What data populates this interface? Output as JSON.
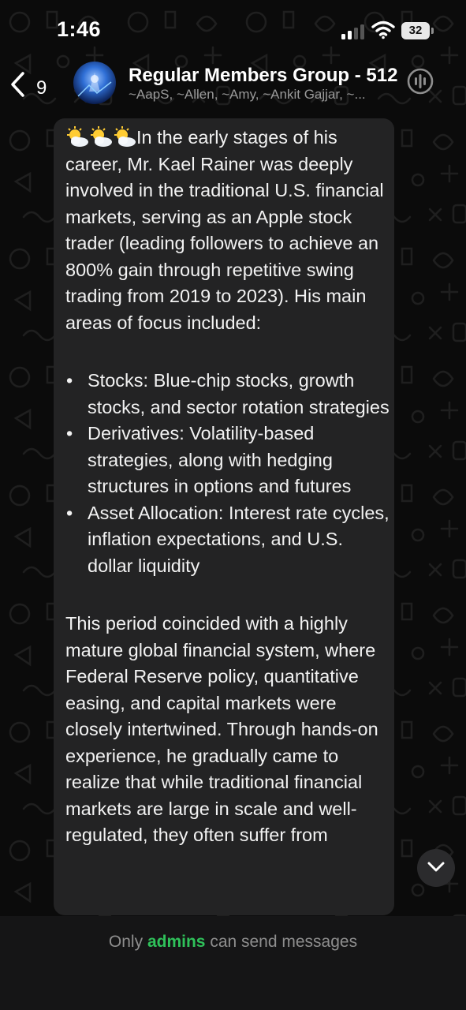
{
  "status_bar": {
    "time": "1:46",
    "battery_level": "32"
  },
  "header": {
    "back_count": "9",
    "title": "Regular Members Group - 512",
    "members": "~AapS, ~Allen, ~Amy, ~Ankit Gajjar, ~..."
  },
  "message": {
    "intro": "In the early stages of his career, Mr. Kael Rainer  was deeply involved in the traditional U.S. financial markets, serving as an Apple stock trader (leading followers to achieve an 800% gain through repetitive swing trading from 2019 to 2023). His main areas of focus included:",
    "bullets": [
      "Stocks: Blue-chip stocks, growth stocks, and sector rotation strategies",
      "Derivatives: Volatility-based strategies, along with hedging structures in options and futures",
      "Asset Allocation: Interest rate cycles, inflation expectations, and U.S. dollar liquidity"
    ],
    "paragraph2": "This period coincided with a highly mature global financial system, where Federal Reserve policy, quantitative easing, and capital markets were closely intertwined. Through hands-on experience, he gradually came to realize that while traditional financial markets are large in scale and well-regulated, they often suffer from"
  },
  "footer": {
    "prefix": "Only",
    "admins": "admins",
    "suffix": "can send messages"
  },
  "icons": {
    "emoji": "sun-behind-cloud-icon",
    "back": "chevron-left-icon",
    "call": "voice-chat-icon",
    "scroll": "chevron-down-icon"
  },
  "colors": {
    "accent_green": "#2fc15a",
    "bubble": "#232324",
    "background": "#0b0b0b"
  }
}
